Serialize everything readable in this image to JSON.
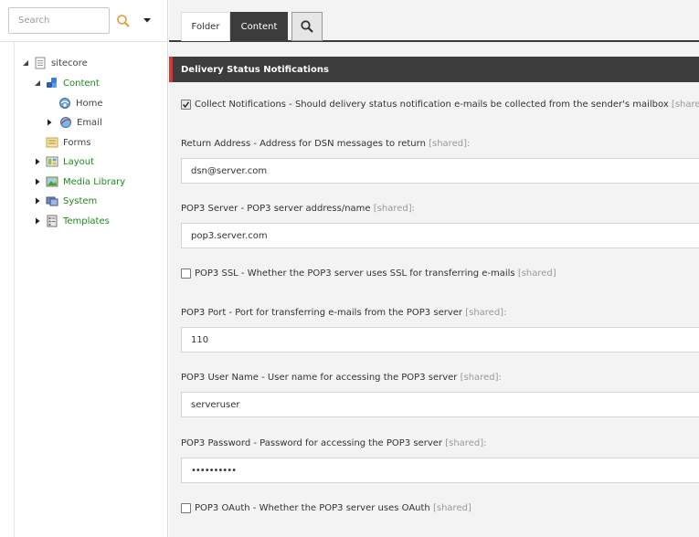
{
  "search": {
    "placeholder": "Search"
  },
  "tree": [
    {
      "label": "sitecore",
      "icon": "sitecore-page-icon",
      "expanded": true
    },
    {
      "label": "Content",
      "icon": "content-icon",
      "expanded": true
    },
    {
      "label": "Home",
      "icon": "home-icon"
    },
    {
      "label": "Email",
      "icon": "email-icon",
      "selected": true
    },
    {
      "label": "Forms",
      "icon": "forms-icon"
    },
    {
      "label": "Layout",
      "icon": "layout-icon"
    },
    {
      "label": "Media Library",
      "icon": "media-library-icon"
    },
    {
      "label": "System",
      "icon": "system-icon"
    },
    {
      "label": "Templates",
      "icon": "templates-icon"
    }
  ],
  "tabs": {
    "folder": "Folder",
    "content": "Content"
  },
  "section": {
    "title": "Delivery Status Notifications"
  },
  "fields": {
    "collect": {
      "label": "Collect Notifications - Should delivery status notification e-mails be collected from the sender's mailbox",
      "shared": "[shared]",
      "checked": true
    },
    "return_address": {
      "label": "Return Address - Address for DSN messages to return",
      "shared": "[shared]:",
      "value": "dsn@server.com"
    },
    "pop3_server": {
      "label": "POP3 Server - POP3 server address/name",
      "shared": "[shared]:",
      "value": "pop3.server.com"
    },
    "pop3_ssl": {
      "label": "POP3 SSL - Whether the POP3 server uses SSL for transferring e-mails",
      "shared": "[shared]",
      "checked": false
    },
    "pop3_port": {
      "label": "POP3 Port - Port for transferring e-mails from the POP3 server",
      "shared": "[shared]:",
      "value": "110"
    },
    "pop3_user": {
      "label": "POP3 User Name - User name for accessing the POP3 server",
      "shared": "[shared]:",
      "value": "serveruser"
    },
    "pop3_password": {
      "label": "POP3 Password - Password for accessing the POP3 server",
      "shared": "[shared]:",
      "value": "••••••••••"
    },
    "pop3_oauth": {
      "label": "POP3 OAuth - Whether the POP3 server uses OAuth",
      "shared": "[shared]",
      "checked": false
    }
  },
  "colors": {
    "tree_green": "#1c8a1c",
    "header_dark": "#3c3c3c",
    "accent_red": "#dd3333"
  }
}
